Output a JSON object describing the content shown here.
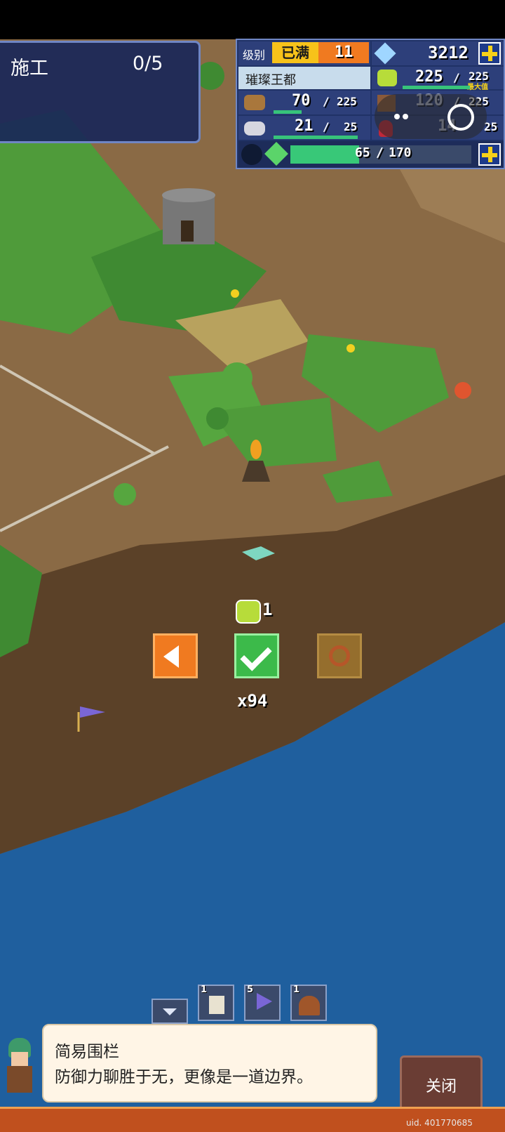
{
  "construction": {
    "label": "施工",
    "count": "0/5"
  },
  "status": {
    "level_label": "级别",
    "level_badge": "已满",
    "level_value": "11",
    "town_name": "璀璨王都",
    "gems": "3212",
    "grass": {
      "value": "225",
      "max": "225",
      "max_tag": "最大值"
    },
    "wood": {
      "value": "70",
      "max": "225"
    },
    "ore": {
      "value": "120",
      "max": "225"
    },
    "stone": {
      "value": "21",
      "max": "25"
    },
    "ruby": {
      "value": "14",
      "max": "25"
    },
    "exp": {
      "value": "65",
      "max": "170",
      "fill_fraction": 0.38
    }
  },
  "placement": {
    "cost": "1",
    "multiplier": "x94"
  },
  "toolbar": {
    "slots": [
      {
        "count": "1",
        "icon": "castle-icon"
      },
      {
        "count": "5",
        "icon": "flag-icon"
      },
      {
        "count": "1",
        "icon": "cave-icon"
      }
    ]
  },
  "dialog": {
    "title": "简易围栏",
    "description": "防御力聊胜于无，更像是一道边界。"
  },
  "close_label": "关闭",
  "uid": "uid. 401770685",
  "colors": {
    "water": "#1f5f9e",
    "dirt": "#8a6a45",
    "grass": "#4f9b3a",
    "panel": "#1c2a55",
    "accent": "#f7d21a"
  }
}
